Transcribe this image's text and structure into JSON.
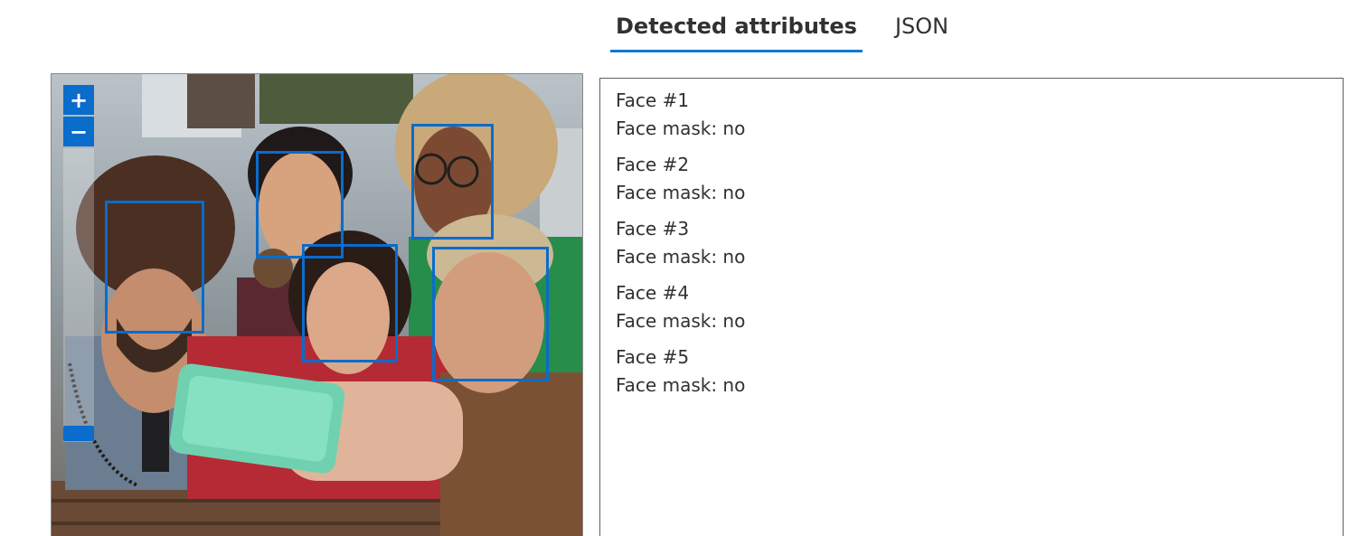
{
  "tabs": [
    {
      "label": "Detected attributes",
      "active": true
    },
    {
      "label": "JSON",
      "active": false
    }
  ],
  "viewer": {
    "zoom_in_label": "+",
    "zoom_out_label": "−",
    "accent_color": "#0a6ccb"
  },
  "faces": [
    {
      "title": "Face #1",
      "mask": "Face mask: no"
    },
    {
      "title": "Face #2",
      "mask": "Face mask: no"
    },
    {
      "title": "Face #3",
      "mask": "Face mask: no"
    },
    {
      "title": "Face #4",
      "mask": "Face mask: no"
    },
    {
      "title": "Face #5",
      "mask": "Face mask: no"
    }
  ]
}
